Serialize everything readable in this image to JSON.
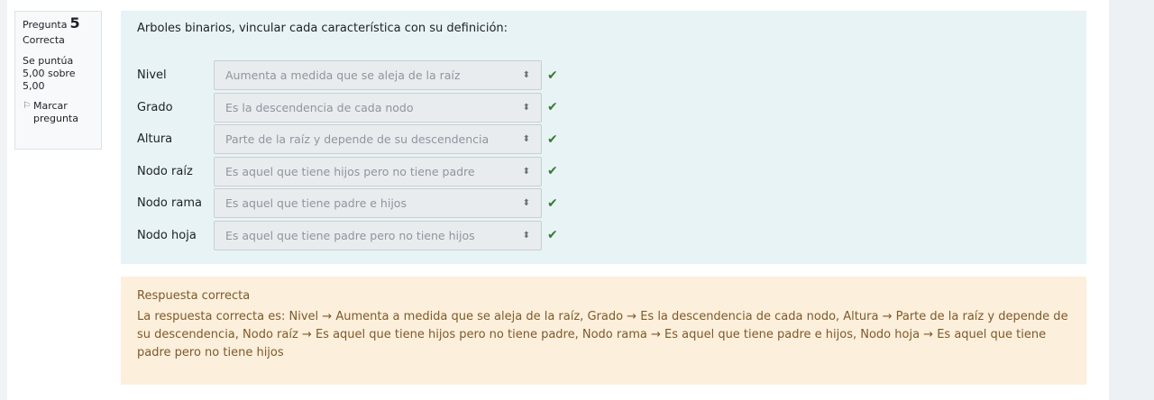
{
  "info": {
    "question_label": "Pregunta",
    "question_number": "5",
    "state": "Correcta",
    "grade": "Se puntúa 5,00 sobre 5,00",
    "flag_label": "Marcar pregunta"
  },
  "question": {
    "text": "Arboles binarios, vincular cada característica con su definición:",
    "rows": [
      {
        "label": "Nivel",
        "selected": "Aumenta a medida que se aleja de la raíz"
      },
      {
        "label": "Grado",
        "selected": "Es la descendencia de cada nodo"
      },
      {
        "label": "Altura",
        "selected": "Parte de la raíz y depende de su descendencia"
      },
      {
        "label": "Nodo raíz",
        "selected": "Es aquel que tiene hijos pero no tiene padre"
      },
      {
        "label": "Nodo rama",
        "selected": "Es aquel que tiene padre e hijos"
      },
      {
        "label": "Nodo hoja",
        "selected": "Es aquel que tiene padre pero no tiene hijos"
      }
    ]
  },
  "feedback": {
    "title": "Respuesta correcta",
    "text": "La respuesta correcta es: Nivel → Aumenta a medida que se aleja de la raíz, Grado → Es la descendencia de cada nodo, Altura → Parte de la raíz y depende de su descendencia, Nodo raíz → Es aquel que tiene hijos pero no tiene padre, Nodo rama → Es aquel que tiene padre e hijos, Nodo hoja → Es aquel que tiene padre pero no tiene hijos"
  },
  "colors": {
    "formulation_bg": "#e7f3f5",
    "feedback_bg": "#fcefdc",
    "feedback_text": "#7d5a29",
    "correct_check": "#357a32"
  }
}
